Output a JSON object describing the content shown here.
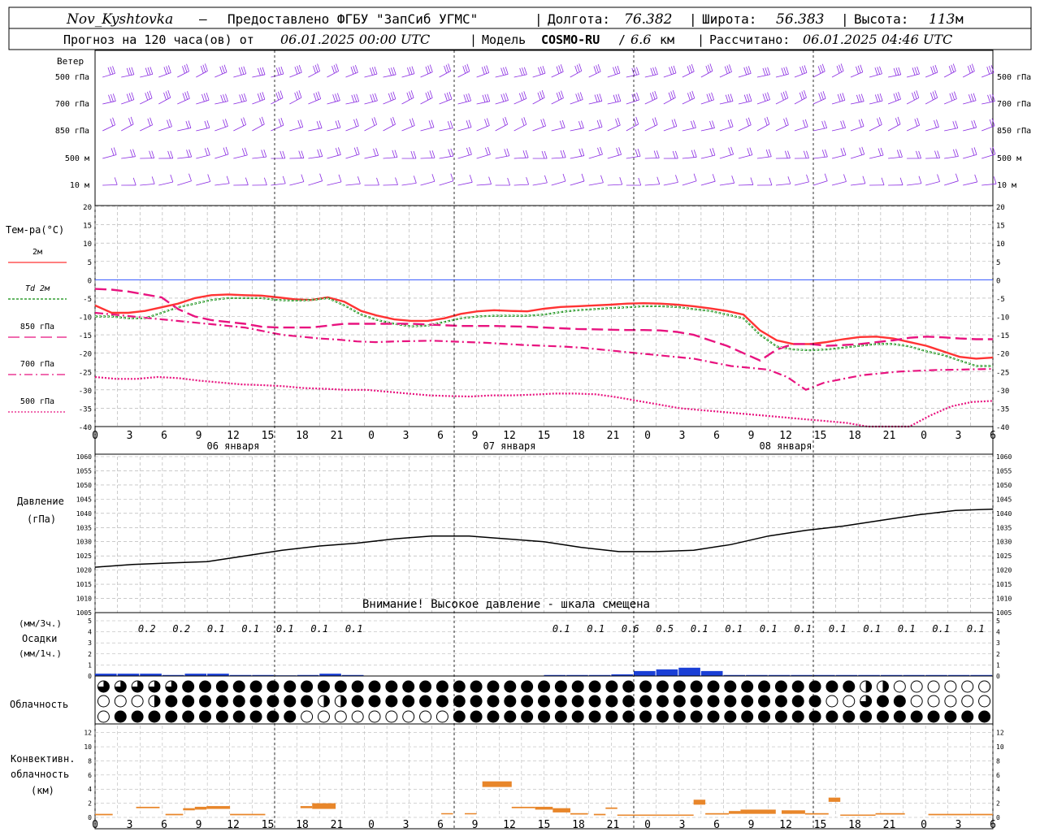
{
  "header": {
    "station": "Nov_Kyshtovka",
    "sep": " — ",
    "provider": "Предоставлено ФГБУ \"ЗапСиб УГМС\"",
    "lon_label": "Долгота:",
    "lon_value": "76.382",
    "lat_label": "Широта:",
    "lat_value": "56.383",
    "alt_label": "Высота:",
    "alt_value": "113",
    "alt_unit": "м",
    "forecast_prefix": "Прогноз на 120 часа(ов) от",
    "forecast_date": "06.01.2025 00:00 UTC",
    "model_label": "Модель",
    "model_name": "COSMO-RU",
    "model_res": "6.6",
    "model_res_unit": "км",
    "computed_label": "Рассчитано:",
    "computed_value": "06.01.2025 04:46 UTC"
  },
  "colors": {
    "wind": "#8a2be2",
    "t2m": "#ff3333",
    "td2m": "#0a8a0a",
    "t850": "#e8137f",
    "t700": "#e8137f",
    "t500": "#e8137f",
    "zero_line": "#3355ff",
    "pressure": "#000000",
    "precip": "#1a3fd6",
    "convective": "#e8862a",
    "grid": "#aaaaaa"
  },
  "time_axis": {
    "ticks": [
      "0",
      "3",
      "6",
      "9",
      "12",
      "15",
      "18",
      "21",
      "0",
      "3",
      "6",
      "9",
      "12",
      "15",
      "18",
      "21",
      "0",
      "3",
      "6",
      "9",
      "12",
      "15",
      "18",
      "21",
      "0",
      "3",
      "6"
    ],
    "days": [
      "06 января",
      "07 января",
      "08 января"
    ]
  },
  "wind_panel": {
    "title": "Ветер",
    "levels": [
      "500 гПа",
      "700 гПа",
      "850 гПа",
      "500 м",
      "10  м"
    ]
  },
  "temp_panel": {
    "title": "Тем-ра(°C)",
    "legend": [
      {
        "label": "2м"
      },
      {
        "label": "Td  2м"
      },
      {
        "label": "850 гПа"
      },
      {
        "label": "700 гПа"
      },
      {
        "label": "500 гПа"
      }
    ],
    "yticks": [
      "20",
      "15",
      "10",
      "5",
      "0",
      "-5",
      "-10",
      "-15",
      "-20",
      "-25",
      "-30",
      "-35",
      "-40"
    ]
  },
  "pressure_panel": {
    "title1": "Давление",
    "title2": "(гПа)",
    "yticks": [
      "1060",
      "1055",
      "1050",
      "1045",
      "1040",
      "1035",
      "1030",
      "1025",
      "1020",
      "1015",
      "1010",
      "1005"
    ],
    "warning": "Внимание! Высокое давление - шкала смещена"
  },
  "precip_panel": {
    "label1": "(мм/3ч.)",
    "label2": "Осадки",
    "label3": "(мм/1ч.)",
    "yticks": [
      "5",
      "4",
      "3",
      "2",
      "1",
      "0"
    ],
    "totals": [
      "0.2",
      "0.2",
      "0.1",
      "0.1",
      "0.1",
      "0.1",
      "0.1",
      "0.1",
      "0.1",
      "0.6",
      "0.5",
      "0.1",
      "0.1",
      "0.1",
      "0.1",
      "0.1",
      "0.1",
      "0.1",
      "0.1",
      "0.1"
    ]
  },
  "cloud_panel": {
    "title": "Облачность"
  },
  "conv_panel": {
    "title1": "Конвективн.",
    "title2": "облачность",
    "title3": "(км)",
    "yticks": [
      "12",
      "10",
      "8",
      "6",
      "4",
      "2",
      "0"
    ]
  },
  "chart_data": [
    {
      "type": "line",
      "title": "Тем-ра(°C)",
      "x_hours": [
        0,
        3,
        6,
        9,
        12,
        15,
        18,
        21,
        24,
        27,
        30,
        33,
        36,
        39,
        42,
        45,
        48,
        51,
        54,
        57,
        60,
        63,
        66,
        69,
        72,
        75,
        78,
        81,
        84,
        87,
        90,
        93,
        96,
        99,
        102,
        105,
        108,
        111,
        114,
        117,
        120
      ],
      "ylim": [
        -40,
        20
      ],
      "series": [
        {
          "name": "2м",
          "values": [
            -7,
            -9,
            -9,
            -8.5,
            -7.5,
            -6.5,
            -5,
            -4.2,
            -4,
            -4.2,
            -4.3,
            -4.8,
            -5.3,
            -5.5,
            -4.8,
            -6,
            -8.5,
            -9.8,
            -10.8,
            -11.2,
            -11.2,
            -10.5,
            -9.3,
            -8.6,
            -8.3,
            -8.5,
            -8.6,
            -7.9,
            -7.4,
            -7.2,
            -7,
            -6.8,
            -6.5,
            -6.4,
            -6.5,
            -6.8,
            -7.2,
            -7.8,
            -8.5,
            -9.5,
            -13.8,
            -16.5,
            -17.5,
            -17.5,
            -17,
            -16.2,
            -15.6,
            -15.5,
            -16,
            -17,
            -18,
            -19.5,
            -21,
            -21.5,
            -21.2
          ]
        },
        {
          "name": "Td 2м",
          "values": [
            -10,
            -10,
            -10.5,
            -10.5,
            -9,
            -7.5,
            -6.5,
            -5.5,
            -5,
            -5,
            -5,
            -5.5,
            -5.7,
            -5.5,
            -5,
            -7,
            -9.5,
            -11,
            -12,
            -12.7,
            -12.5,
            -11.5,
            -10.5,
            -10,
            -9.8,
            -9.8,
            -9.8,
            -9.5,
            -8.8,
            -8.3,
            -8,
            -7.7,
            -7.5,
            -7.2,
            -7.2,
            -7.4,
            -8,
            -8.5,
            -9.5,
            -10.5,
            -15,
            -18.2,
            -19,
            -19.2,
            -19,
            -18.5,
            -18,
            -17.5,
            -17.5,
            -18.2,
            -19.5,
            -20.5,
            -22,
            -23.5,
            -23.5
          ]
        },
        {
          "name": "850 гПа",
          "values": [
            -2.5,
            -2.7,
            -3.2,
            -4,
            -4.8,
            -8,
            -10,
            -11,
            -11.5,
            -12,
            -12.8,
            -13,
            -13,
            -13,
            -12.5,
            -12,
            -12,
            -12,
            -12,
            -12,
            -12.2,
            -12.4,
            -12.6,
            -12.6,
            -12.6,
            -12.7,
            -12.8,
            -13,
            -13.2,
            -13.4,
            -13.5,
            -13.6,
            -13.7,
            -13.7,
            -13.8,
            -14.2,
            -15,
            -16.5,
            -18,
            -20,
            -22,
            -19,
            -17.5,
            -17.5,
            -18,
            -17.8,
            -17.5,
            -17,
            -16.5,
            -15.8,
            -15.5,
            -15.7,
            -16,
            -16.2,
            -16.2
          ]
        },
        {
          "name": "700 гПа",
          "values": [
            -9,
            -9.5,
            -10,
            -10.5,
            -11,
            -11.5,
            -12,
            -12.5,
            -13,
            -14,
            -15,
            -15.5,
            -16,
            -16.3,
            -16.8,
            -17,
            -16.8,
            -16.7,
            -16.6,
            -16.8,
            -17,
            -17.2,
            -17.5,
            -17.8,
            -18,
            -18.2,
            -18.5,
            -19,
            -19.5,
            -20,
            -20.5,
            -21,
            -21.5,
            -22.5,
            -23.5,
            -24,
            -24.5,
            -26.5,
            -30,
            -28,
            -27,
            -26,
            -25.5,
            -25,
            -24.8,
            -24.6,
            -24.5,
            -24.4,
            -24.3
          ]
        },
        {
          "name": "500 гПа",
          "values": [
            -26.5,
            -27,
            -27,
            -26.5,
            -26.8,
            -27.5,
            -28,
            -28.5,
            -28.7,
            -29,
            -29.5,
            -29.7,
            -30,
            -30,
            -30.5,
            -31,
            -31.5,
            -31.7,
            -31.8,
            -31.5,
            -31.5,
            -31.3,
            -31,
            -31,
            -31.2,
            -32,
            -33,
            -34,
            -35,
            -35.5,
            -36,
            -36.5,
            -37,
            -37.5,
            -38,
            -38.5,
            -39,
            -40,
            -41,
            -40,
            -37,
            -34.5,
            -33.3,
            -33
          ]
        }
      ]
    },
    {
      "type": "line",
      "title": "Давление",
      "x_hours": [
        0,
        6,
        12,
        18,
        24,
        30,
        36,
        42,
        48,
        54,
        60,
        66,
        72,
        78,
        84,
        90,
        96,
        102,
        108,
        114,
        120
      ],
      "ylim": [
        1005,
        1060
      ],
      "series": [
        {
          "name": "Давление",
          "values": [
            1021,
            1022,
            1022.5,
            1023,
            1025,
            1027,
            1028.5,
            1029.5,
            1031,
            1032,
            1032,
            1031,
            1030,
            1028,
            1026.5,
            1026.5,
            1027,
            1029,
            1032,
            1034,
            1035.5,
            1037.5,
            1039.5,
            1041,
            1041.5
          ]
        }
      ]
    },
    {
      "type": "bar",
      "title": "Осадки",
      "x_hours": [
        0,
        3,
        6,
        9,
        12,
        15,
        18,
        21,
        24,
        27,
        30,
        33,
        36,
        39,
        42,
        45,
        48,
        51,
        54,
        57,
        60,
        63,
        66,
        69,
        72,
        75,
        78,
        81,
        84,
        87,
        90,
        93,
        96,
        99,
        102,
        105,
        108,
        111,
        114,
        117
      ],
      "ylim": [
        0,
        5
      ],
      "values_mm_per_hour": [
        0.07,
        0.07,
        0.07,
        0.03,
        0.07,
        0.07,
        0.03,
        0.03,
        0.02,
        0.03,
        0.07,
        0.03,
        0,
        0,
        0,
        0,
        0,
        0,
        0,
        0,
        0.03,
        0.03,
        0.03,
        0.05,
        0.15,
        0.2,
        0.25,
        0.15,
        0.03,
        0.03,
        0.03,
        0.03,
        0.03,
        0.03,
        0.03,
        0.03,
        0.03,
        0.03,
        0.03,
        0.03
      ]
    },
    {
      "type": "bar",
      "title": "Конвективн. облачность",
      "ylim": [
        0,
        13
      ],
      "segments": [
        {
          "x0": 0,
          "x1": 1.5,
          "bottom": 0.3,
          "top": 0.5
        },
        {
          "x0": 3.5,
          "x1": 5.5,
          "bottom": 1.3,
          "top": 1.5
        },
        {
          "x0": 6,
          "x1": 7.5,
          "bottom": 0.3,
          "top": 0.5
        },
        {
          "x0": 7.5,
          "x1": 8.5,
          "bottom": 1,
          "top": 1.3
        },
        {
          "x0": 8.5,
          "x1": 9.5,
          "bottom": 1.1,
          "top": 1.5
        },
        {
          "x0": 9.5,
          "x1": 11.5,
          "bottom": 1.2,
          "top": 1.6
        },
        {
          "x0": 11.5,
          "x1": 14.5,
          "bottom": 0.3,
          "top": 0.5
        },
        {
          "x0": 17.5,
          "x1": 18.5,
          "bottom": 1.3,
          "top": 1.6
        },
        {
          "x0": 18.5,
          "x1": 20.5,
          "bottom": 1.2,
          "top": 2.0
        },
        {
          "x0": 29.5,
          "x1": 30.5,
          "bottom": 0.5,
          "top": 0.6
        },
        {
          "x0": 31.5,
          "x1": 32.5,
          "bottom": 0.5,
          "top": 0.6
        },
        {
          "x0": 33,
          "x1": 35.5,
          "bottom": 4.3,
          "top": 5.1
        },
        {
          "x0": 35.5,
          "x1": 37.5,
          "bottom": 1.3,
          "top": 1.5
        },
        {
          "x0": 37.5,
          "x1": 39,
          "bottom": 1.1,
          "top": 1.5
        },
        {
          "x0": 39,
          "x1": 40.5,
          "bottom": 0.7,
          "top": 1.3
        },
        {
          "x0": 40.5,
          "x1": 42,
          "bottom": 0.4,
          "top": 0.6
        },
        {
          "x0": 42.5,
          "x1": 43.5,
          "bottom": 0.3,
          "top": 0.5
        },
        {
          "x0": 43.5,
          "x1": 44.5,
          "bottom": 1.2,
          "top": 1.4
        },
        {
          "x0": 44.5,
          "x1": 51,
          "bottom": 0.3,
          "top": 0.4
        },
        {
          "x0": 51,
          "x1": 52,
          "bottom": 1.8,
          "top": 2.5
        },
        {
          "x0": 52,
          "x1": 54,
          "bottom": 0.4,
          "top": 0.6
        },
        {
          "x0": 54,
          "x1": 55,
          "bottom": 0.5,
          "top": 0.9
        },
        {
          "x0": 55,
          "x1": 58,
          "bottom": 0.5,
          "top": 1.1
        },
        {
          "x0": 58.5,
          "x1": 60.5,
          "bottom": 0.5,
          "top": 1.0
        },
        {
          "x0": 60.5,
          "x1": 62.5,
          "bottom": 0.4,
          "top": 0.6
        },
        {
          "x0": 62.5,
          "x1": 63.5,
          "bottom": 2.2,
          "top": 2.8
        },
        {
          "x0": 63.5,
          "x1": 66.5,
          "bottom": 0.3,
          "top": 0.4
        },
        {
          "x0": 66.5,
          "x1": 69,
          "bottom": 0.4,
          "top": 0.6
        },
        {
          "x0": 71,
          "x1": 76.5,
          "bottom": 0.3,
          "top": 0.5
        }
      ]
    }
  ]
}
